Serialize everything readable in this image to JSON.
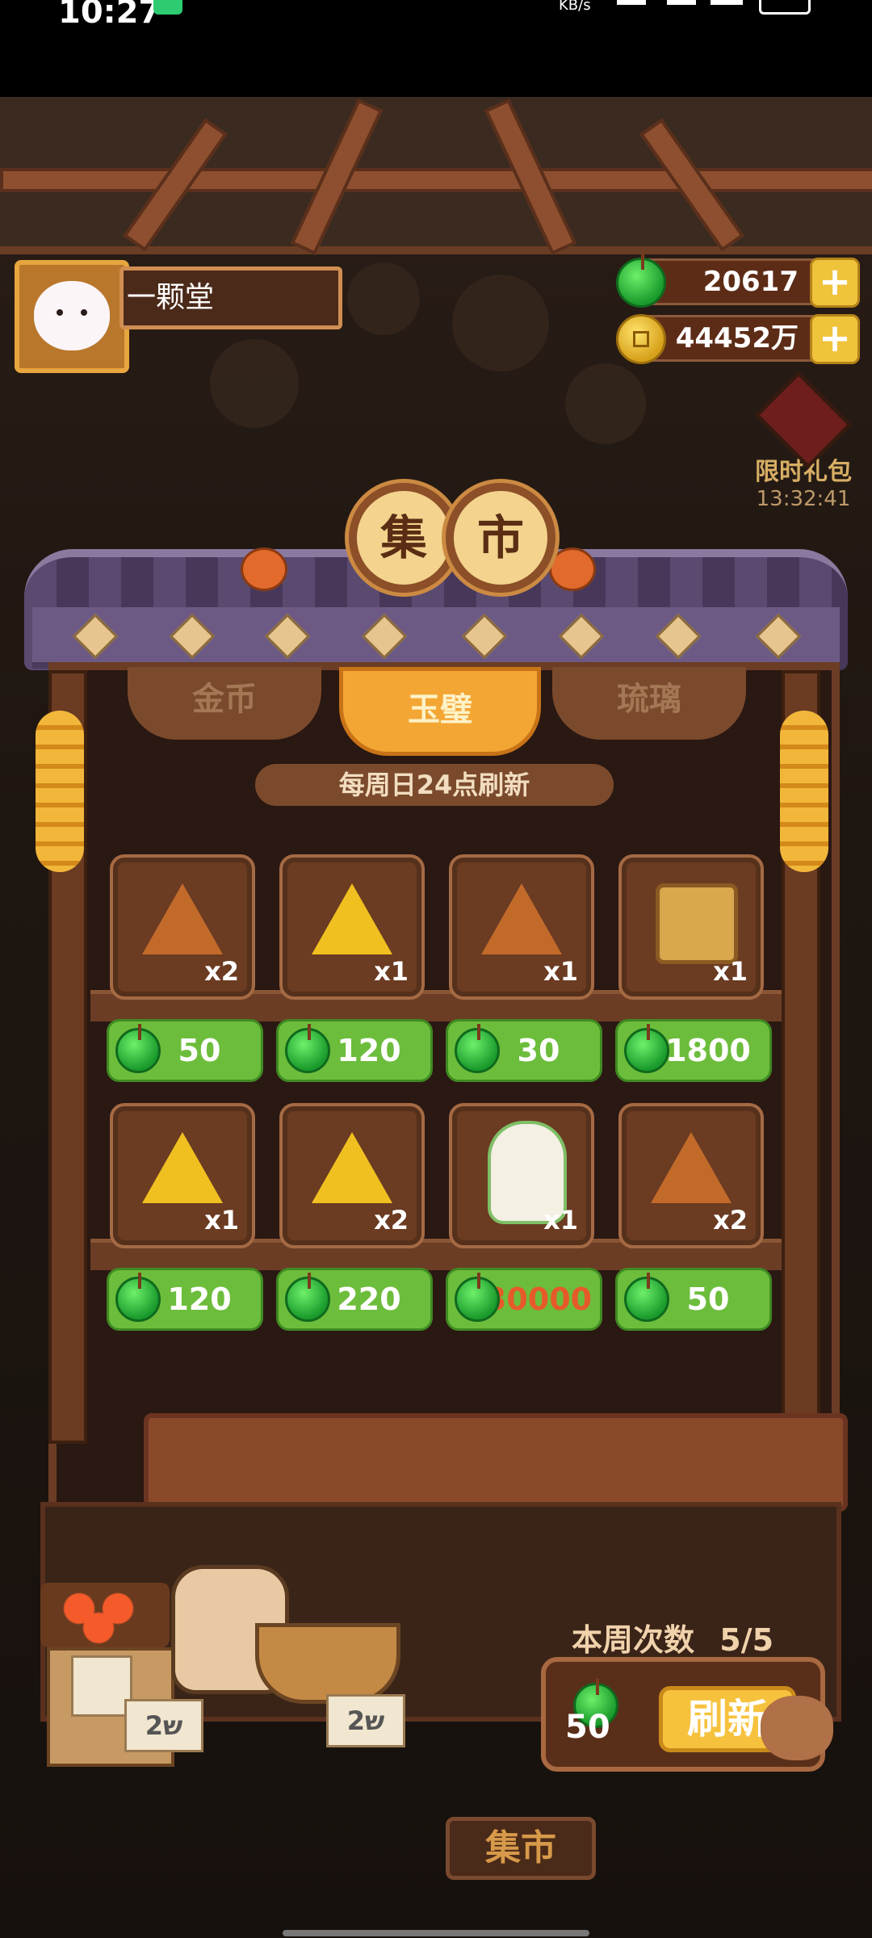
{
  "status_bar": {
    "time": "10:27",
    "network_speed": "KB/s"
  },
  "player": {
    "name": "一颗堂"
  },
  "resources": {
    "jade": {
      "icon": "jade-icon",
      "value": "20617"
    },
    "gold": {
      "icon": "gold-coin-icon",
      "value": "44452万"
    }
  },
  "limited_gift": {
    "label": "限时礼包",
    "timer": "13:32:41"
  },
  "market": {
    "title_chars": [
      "集",
      "市"
    ],
    "tabs": [
      {
        "label": "金币",
        "active": false
      },
      {
        "label": "玉璧",
        "active": true
      },
      {
        "label": "琉璃",
        "active": false
      }
    ],
    "refresh_notice": "每周日24点刷新",
    "items": [
      {
        "icon": "bronze-jade-disc-icon",
        "qty": "x2",
        "price": "50"
      },
      {
        "icon": "gold-jade-disc-icon",
        "qty": "x1",
        "price": "120"
      },
      {
        "icon": "bronze-jade-disc-icon",
        "qty": "x1",
        "price": "30"
      },
      {
        "icon": "treasure-chest-icon",
        "qty": "x1",
        "price": "1800"
      },
      {
        "icon": "gold-star-disc-icon",
        "qty": "x1",
        "price": "120"
      },
      {
        "icon": "gold-spiral-disc-icon",
        "qty": "x2",
        "price": "220"
      },
      {
        "icon": "character-skin-icon",
        "qty": "x1",
        "price": "30000"
      },
      {
        "icon": "bronze-sun-disc-icon",
        "qty": "x2",
        "price": "50"
      }
    ],
    "price_currency_icon": "jade-icon",
    "price_color_unaffordable": "#e65a2a"
  },
  "refresh": {
    "weekly_label": "本周次数",
    "weekly_count": "5/5",
    "cost": "50",
    "button_label": "刷新"
  },
  "stall_tags": [
    "ש2",
    "ש2"
  ],
  "bottom_sign": "集市",
  "colors": {
    "accent_gold": "#f3a634",
    "price_green": "#6dbd3c",
    "wood": "#6b3d24"
  }
}
